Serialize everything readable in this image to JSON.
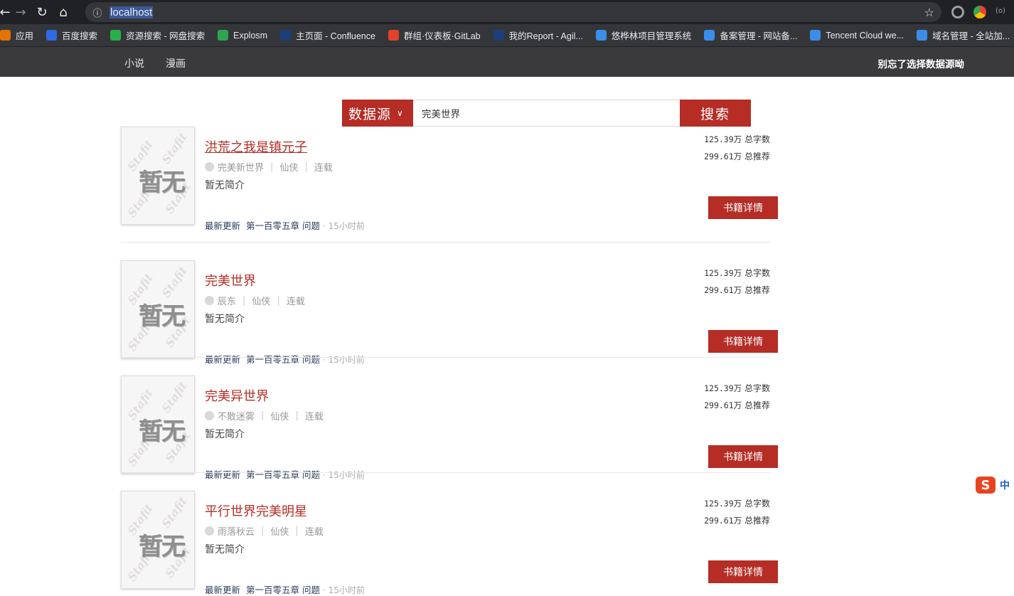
{
  "browser": {
    "url": "localhost",
    "bookmarks": [
      {
        "label": "应用",
        "color": "#e37400"
      },
      {
        "label": "百度搜索",
        "color": "#2f6be0"
      },
      {
        "label": "资源搜索 - 网盘搜索",
        "color": "#28b04a"
      },
      {
        "label": "Explosm",
        "color": "#2ea44f"
      },
      {
        "label": "主页面 - Confluence",
        "color": "#1c3f7a"
      },
      {
        "label": "群组·仪表板·GitLab",
        "color": "#e2432a"
      },
      {
        "label": "我的Report - Agil...",
        "color": "#1c3f7a"
      },
      {
        "label": "悠桦林项目管理系统",
        "color": "#3b8ee8"
      },
      {
        "label": "备案管理 - 网站备...",
        "color": "#3b8ee8"
      },
      {
        "label": "Tencent Cloud we...",
        "color": "#3b8ee8"
      },
      {
        "label": "域名管理 - 全站加...",
        "color": "#3b8ee8"
      }
    ]
  },
  "nav": {
    "links": [
      "小说",
      "漫画"
    ],
    "right_text": "别忘了选择数据源呦"
  },
  "search": {
    "source_label": "数据源",
    "query": "完美世界",
    "button_label": "搜索"
  },
  "books": [
    {
      "title": "洪荒之我是镇元子",
      "author": "完美新世界",
      "genre": "仙侠",
      "status": "连载",
      "intro": "暂无简介",
      "latest_label": "最新更新",
      "latest_chapter": "第一百零五章  问题",
      "time": "15小时前",
      "words": "125.39万",
      "words_label": "总字数",
      "recommend": "299.61万",
      "recommend_label": "总推荐",
      "detail_label": "书籍详情",
      "cover_text": "暂无",
      "cover_wm": "Stafit"
    },
    {
      "title": "完美世界",
      "author": "辰东",
      "genre": "仙侠",
      "status": "连载",
      "intro": "暂无简介",
      "latest_label": "最新更新",
      "latest_chapter": "第一百零五章  问题",
      "time": "15小时前",
      "words": "125.39万",
      "words_label": "总字数",
      "recommend": "299.61万",
      "recommend_label": "总推荐",
      "detail_label": "书籍详情",
      "cover_text": "暂无",
      "cover_wm": "Stafit"
    },
    {
      "title": "完美异世界",
      "author": "不散迷雾",
      "genre": "仙侠",
      "status": "连载",
      "intro": "暂无简介",
      "latest_label": "最新更新",
      "latest_chapter": "第一百零五章  问题",
      "time": "15小时前",
      "words": "125.39万",
      "words_label": "总字数",
      "recommend": "299.61万",
      "recommend_label": "总推荐",
      "detail_label": "书籍详情",
      "cover_text": "暂无",
      "cover_wm": "Stafit"
    },
    {
      "title": "平行世界完美明星",
      "author": "雨落秋云",
      "genre": "仙侠",
      "status": "连载",
      "intro": "暂无简介",
      "latest_label": "最新更新",
      "latest_chapter": "第一百零五章  问题",
      "time": "15小时前",
      "words": "125.39万",
      "words_label": "总字数",
      "recommend": "299.61万",
      "recommend_label": "总推荐",
      "detail_label": "书籍详情",
      "cover_text": "暂无",
      "cover_wm": "Stafit"
    }
  ],
  "ime": {
    "logo": "S",
    "mode": "中"
  }
}
